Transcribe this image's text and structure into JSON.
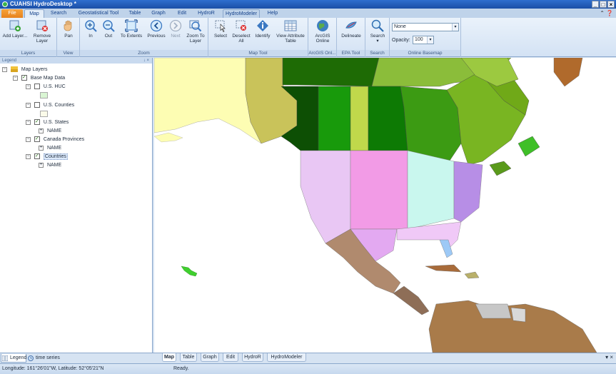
{
  "window": {
    "title": "CUAHSI HydroDesktop *",
    "controls": [
      "_",
      "□",
      "×"
    ]
  },
  "ribbon_tabs": [
    "File",
    "Map",
    "Search",
    "Geostatistical Tool",
    "Table",
    "Graph",
    "Edit",
    "HydroR",
    "HydroModeler",
    "Help"
  ],
  "active_tab": "Map",
  "ribbon": {
    "layers": {
      "group": "Layers",
      "add": "Add Layer...",
      "remove_1": "Remove",
      "remove_2": "Layer"
    },
    "view": {
      "group": "View",
      "pan": "Pan"
    },
    "zoom": {
      "group": "Zoom",
      "in": "In",
      "out": "Out",
      "extents": "To Extents",
      "previous": "Previous",
      "next": "Next",
      "zoom_layer_1": "Zoom To",
      "zoom_layer_2": "Layer"
    },
    "map_tool": {
      "group": "Map Tool",
      "select": "Select",
      "deselect_1": "Deselect",
      "deselect_2": "All",
      "identify": "Identify",
      "attr_1": "View Attribute",
      "attr_2": "Table"
    },
    "arcgis": {
      "group": "ArcGIS Onl...",
      "btn_1": "ArcGIS",
      "btn_2": "Online"
    },
    "epa": {
      "group": "EPA Tool",
      "delineate": "Delineate"
    },
    "search": {
      "group": "Search",
      "btn": "Search"
    },
    "basemap": {
      "group": "Online Basemap",
      "selected": "None",
      "opacity_label": "Opacity:",
      "opacity_value": "100"
    }
  },
  "legend": {
    "panel_title": "Legend",
    "panel_buttons": "↓ ×",
    "root": "Map Layers",
    "group": "Base Map Data",
    "layers": [
      {
        "name": "U.S. HUC",
        "checked": false,
        "swatch": "#d9f5d3"
      },
      {
        "name": "U.S. Counties",
        "checked": false,
        "swatch": "#fbfbe9"
      },
      {
        "name": "U.S. States",
        "checked": true,
        "field": "NAME"
      },
      {
        "name": "Canada Provinces",
        "checked": true,
        "field": "NAME"
      },
      {
        "name": "Countries",
        "checked": true,
        "field": "NAME",
        "selected": true
      }
    ]
  },
  "legend_tabs": [
    "Legend",
    "time series"
  ],
  "map_tabs": [
    "Map",
    "Table",
    "Graph",
    "Edit",
    "HydroR",
    "HydroModeler"
  ],
  "map_tabs_controls": "▾ ×",
  "status": {
    "coords": "Longitude: 161°26'01\"W, Latitude: 52°05'21\"N",
    "state": "Ready."
  },
  "colors": {
    "accent": "#2f6fcf",
    "file_tab": "#e6821d",
    "ribbon": "#d3e2f4",
    "ocean": "#ffffff"
  }
}
